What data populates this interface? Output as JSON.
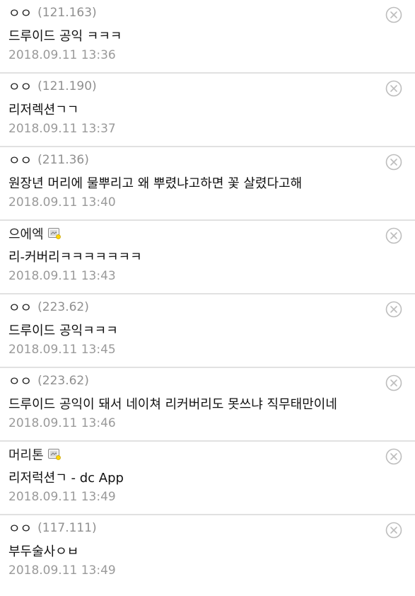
{
  "comments": [
    {
      "nick": "ㅇㅇ",
      "ip": "(121.163)",
      "text": "드루이드 공익 ㅋㅋㅋ",
      "date": "2018.09.11 13:36",
      "gallog": false
    },
    {
      "nick": "ㅇㅇ",
      "ip": "(121.190)",
      "text": "리저렉션ㄱㄱ",
      "date": "2018.09.11 13:37",
      "gallog": false
    },
    {
      "nick": "ㅇㅇ",
      "ip": "(211.36)",
      "text": "원장년 머리에 물뿌리고 왜 뿌렸냐고하면 꽃 살렸다고해",
      "date": "2018.09.11 13:40",
      "gallog": false
    },
    {
      "nick": "으에엑",
      "ip": "",
      "text": "리-커버리ㅋㅋㅋㅋㅋㅋㅋ",
      "date": "2018.09.11 13:43",
      "gallog": true
    },
    {
      "nick": "ㅇㅇ",
      "ip": "(223.62)",
      "text": "드루이드 공익ㅋㅋㅋ",
      "date": "2018.09.11 13:45",
      "gallog": false
    },
    {
      "nick": "ㅇㅇ",
      "ip": "(223.62)",
      "text": "드루이드 공익이 돼서 네이쳐 리커버리도 못쓰냐 직무태만이네",
      "date": "2018.09.11 13:46",
      "gallog": false
    },
    {
      "nick": "머리톤",
      "ip": "",
      "text": "리저럭션ㄱ - dc App",
      "date": "2018.09.11 13:49",
      "gallog": true
    },
    {
      "nick": "ㅇㅇ",
      "ip": "(117.111)",
      "text": "부두술사ㅇㅂ",
      "date": "2018.09.11 13:49",
      "gallog": false
    }
  ],
  "icons": {
    "delete": "close-circle-icon",
    "gallog": "gallog-icon"
  },
  "colors": {
    "divider": "#e1e1e1",
    "ip": "#8f8f8f",
    "date": "#9a9a9a",
    "delete_icon": "#bdbdbd"
  }
}
